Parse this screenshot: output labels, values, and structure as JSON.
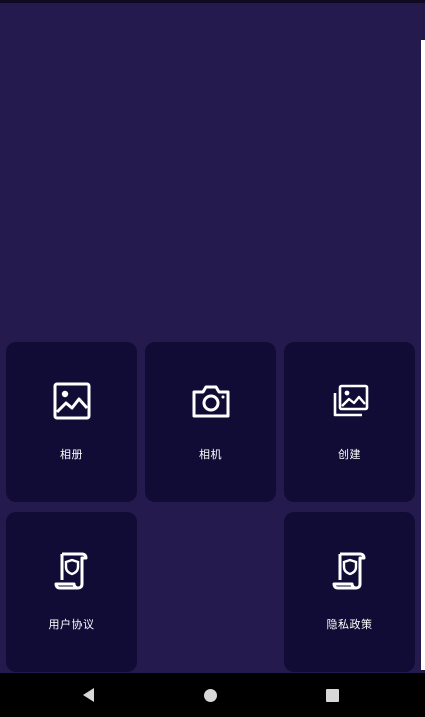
{
  "menu": {
    "items": [
      {
        "label": "相册",
        "icon": "image-icon"
      },
      {
        "label": "相机",
        "icon": "camera-icon"
      },
      {
        "label": "创建",
        "icon": "photos-icon"
      },
      {
        "label": "用户协议",
        "icon": "document-shield-icon"
      },
      {
        "label": "隐私政策",
        "icon": "document-shield-icon"
      }
    ]
  },
  "system_nav": {
    "buttons": [
      "back-icon",
      "home-icon",
      "recent-apps-icon"
    ]
  },
  "colors": {
    "background": "#251a4d",
    "tile": "#110c35",
    "nav_bar": "#000000",
    "icon": "#ffffff"
  }
}
